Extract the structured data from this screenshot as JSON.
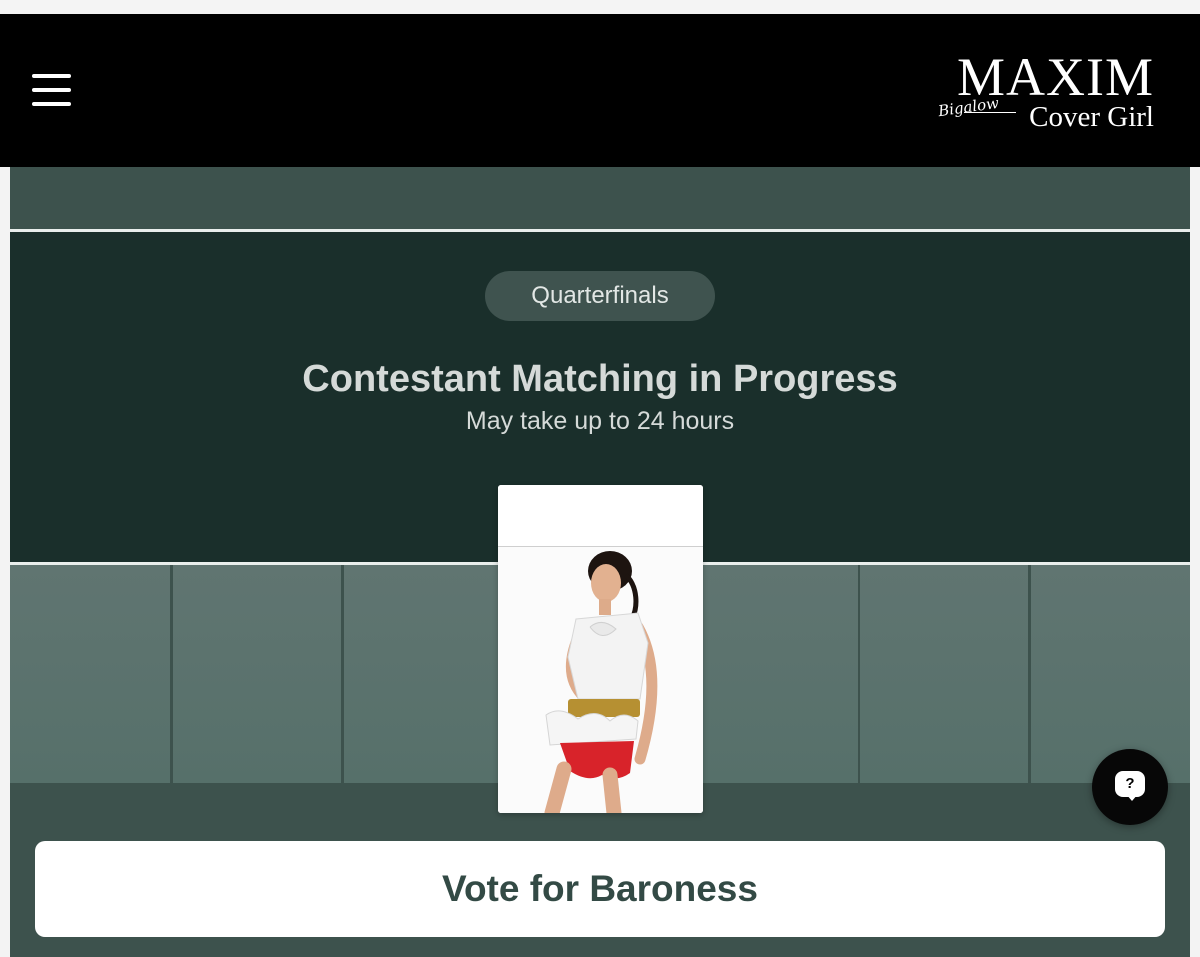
{
  "header": {
    "menu_icon": "hamburger-menu-icon",
    "logo": {
      "main": "MAXIM",
      "script": "Bigalow",
      "sub": "Cover Girl"
    }
  },
  "competition": {
    "round_label": "Quarterfinals",
    "title": "Contestant Matching in Progress",
    "subtitle": "May take up to 24 hours"
  },
  "vote": {
    "label": "Vote for Baroness"
  },
  "chat": {
    "icon": "help-chat-icon",
    "glyph": "?"
  },
  "colors": {
    "header_bg": "#000000",
    "hero_bg": "#1a2f2b",
    "page_bg": "#3d524d",
    "pill_bg": "#3f534f",
    "button_text": "#334a45"
  }
}
